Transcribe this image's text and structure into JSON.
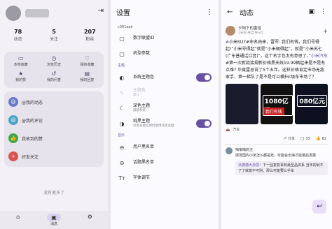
{
  "p1": {
    "stats": [
      {
        "n": "78",
        "l": "动态"
      },
      {
        "n": "5",
        "l": "关注"
      },
      {
        "n": "207",
        "l": "粉丝"
      }
    ],
    "grid": [
      {
        "icon": "▭",
        "name": "local-favorites-icon",
        "label": "本地收藏"
      },
      {
        "icon": "◷",
        "name": "history-icon",
        "label": "浏览历史"
      },
      {
        "icon": "♡",
        "name": "my-favorites-icon",
        "label": "我的收藏"
      },
      {
        "icon": "★",
        "name": "my-likes-icon",
        "label": "我的赞"
      },
      {
        "icon": "↺",
        "name": "my-questions-icon",
        "label": "我的问答"
      },
      {
        "icon": "▤",
        "name": "my-replies-icon",
        "label": "我的回复"
      }
    ],
    "menu": [
      {
        "icon": "@",
        "name": "at-icon",
        "color": "#6b79c9",
        "label": "@我的动态"
      },
      {
        "icon": "@",
        "name": "at-comment-icon",
        "color": "#4aa3c7",
        "label": "@我的评论"
      },
      {
        "icon": "👍",
        "name": "like-icon",
        "color": "#3ea84a",
        "label": "我收到的赞"
      },
      {
        "icon": "+",
        "name": "follow-icon",
        "color": "#d9534f",
        "label": "好友关注"
      }
    ],
    "nomore": "没有更多了",
    "nav": {
      "msg": "消息"
    }
  },
  "p2": {
    "title": "设置",
    "account": "c001apk",
    "rows1": [
      {
        "icon": "▢",
        "name": "device-id-icon",
        "title": "数字联盟ID"
      },
      {
        "icon": "▢",
        "name": "device-params-icon",
        "title": "机型参数"
      }
    ],
    "theme_head": "主题",
    "system_color": "系统主题色",
    "theme_color": {
      "title": "主题色",
      "sub": "默认"
    },
    "dark": {
      "title": "深色主题",
      "sub": "跟随系统"
    },
    "pure_black": {
      "title": "纯黑主题",
      "sub": "深色主题启用时使用纯黑主题"
    },
    "display_head": "显示",
    "rows2": [
      {
        "icon": "⊖",
        "name": "user-blacklist-icon",
        "title": "用户黑名单"
      },
      {
        "icon": "⊖",
        "name": "topic-blacklist-icon",
        "title": "话题黑名单"
      },
      {
        "icon": "Tт",
        "name": "font-size-icon",
        "title": "字体调节"
      }
    ]
  },
  "p3": {
    "title": "动态",
    "user": {
      "name": "夕阳下的雷佳",
      "meta": "1天前  来自 Neo5"
    },
    "text": "小米SU7#命名由来，雷军: 我们有钱，我们号得起!“小米号得起”就是“小米辍得起”，就是“小米苏七(广东普通话口音)”，这个名字也太有意思了。”",
    "text2": "小米汽车",
    "text3": "#第一次新款接规新价格黑夫线19.99辆起来是不是有点难? 毕竟雷总说了5个五年。这样价格肯定市场无敌家手，第一梯队了是不是可以横扫c级车市场了？",
    "nums": [
      "1080亿元",
      "080亿元"
    ],
    "tag": "我们有钱",
    "tagline": "汽车",
    "actions": {
      "share": "分享",
      "comment": "33",
      "like": "82"
    },
    "comment": {
      "name": "嗡嗡嗡的汪",
      "text": "感觉国内小米怎么都是死，可能会出海才能最后发展"
    },
    "reply": {
      "user": "沃德德大孙层",
      "text": "：下一回复复事有最至品资系 当年的就不了了就能不可别。那么可能要么手车"
    }
  }
}
